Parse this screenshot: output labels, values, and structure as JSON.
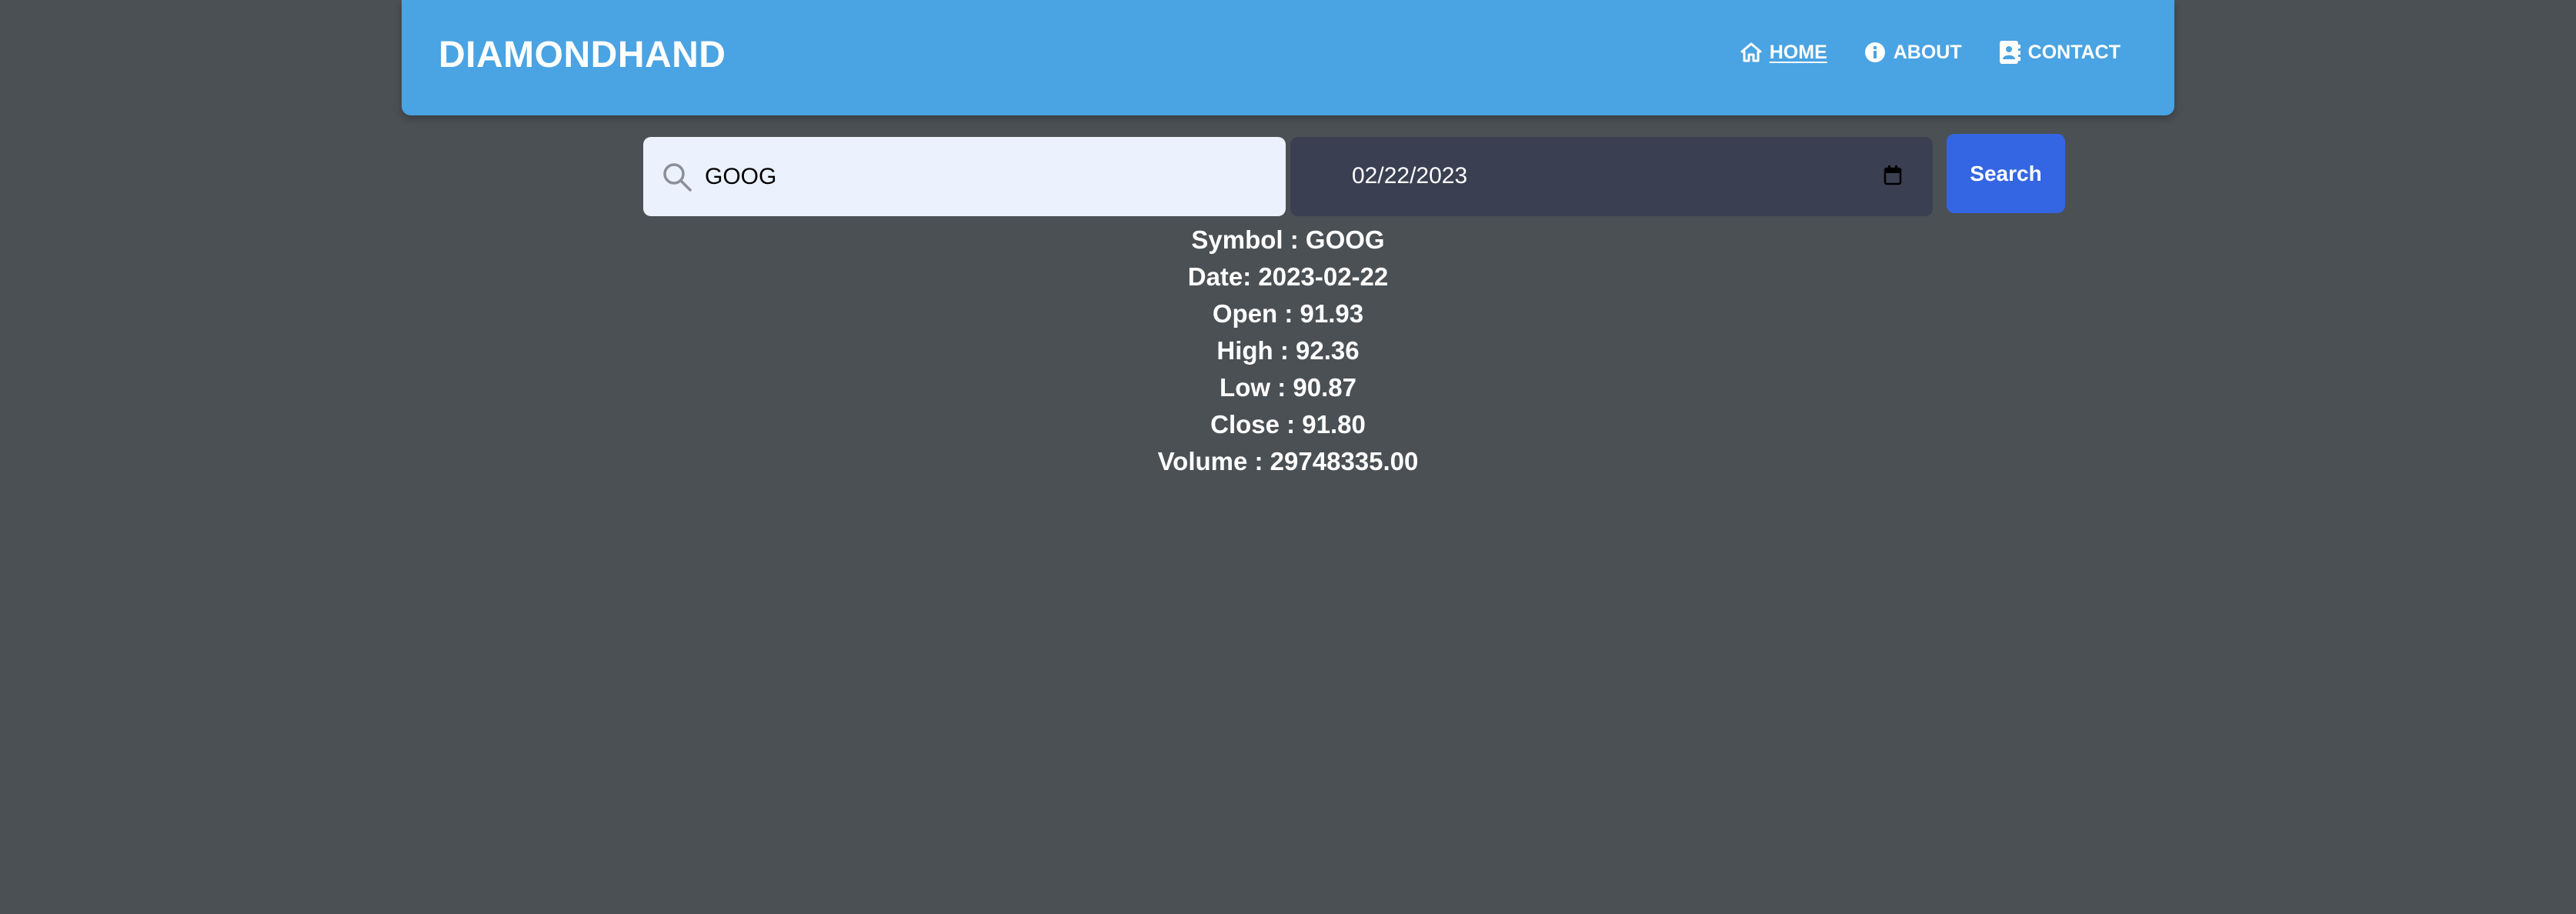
{
  "brand": "DIAMONDHAND",
  "nav": [
    {
      "label": "HOME",
      "icon": "home-icon",
      "active": true
    },
    {
      "label": "ABOUT",
      "icon": "info-icon",
      "active": false
    },
    {
      "label": "CONTACT",
      "icon": "contact-icon",
      "active": false
    }
  ],
  "search": {
    "value": "GOOG",
    "icon": "search-icon"
  },
  "date": {
    "value": "02/22/2023",
    "icon": "calendar-icon"
  },
  "search_button": "Search",
  "results": [
    "Symbol : GOOG",
    "Date: 2023-02-22",
    "Open : 91.93",
    "High : 92.36",
    "Low : 90.87",
    "Close : 91.80",
    "Volume : 29748335.00"
  ],
  "colors": {
    "background": "#4b5054",
    "navbar": "#4aa3e2",
    "search_field": "#ebf2fe",
    "date_field": "#3a3f51",
    "button": "#3466e3"
  }
}
